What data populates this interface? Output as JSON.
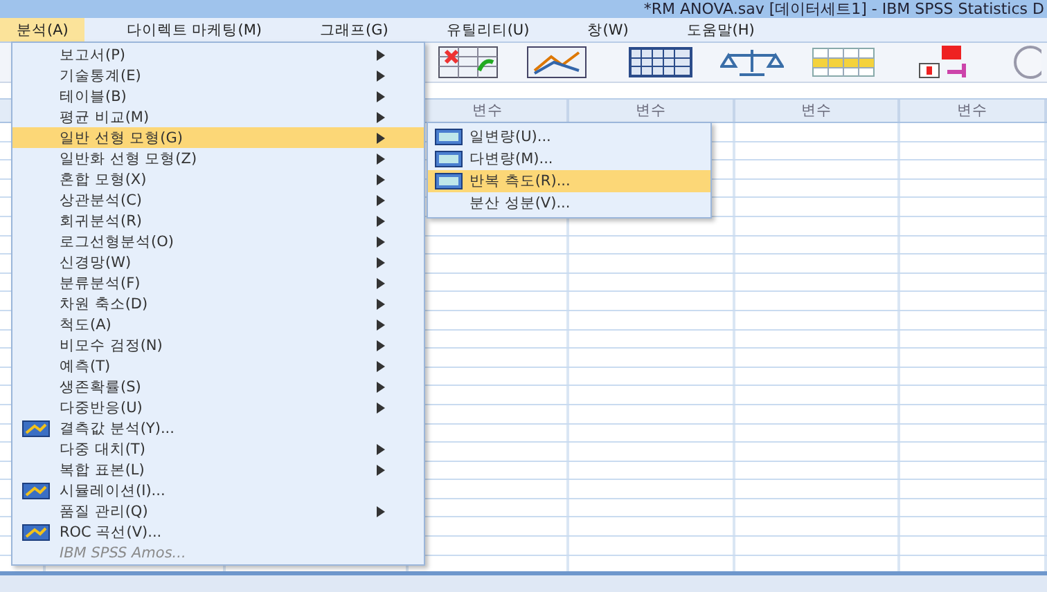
{
  "window": {
    "title": "*RM ANOVA.sav [데이터세트1] - IBM SPSS Statistics D"
  },
  "menubar": [
    {
      "label": "분석(A)",
      "selected": true
    },
    {
      "label": "다이렉트 마케팅(M)",
      "selected": false
    },
    {
      "label": "그래프(G)",
      "selected": false
    },
    {
      "label": "유틸리티(U)",
      "selected": false
    },
    {
      "label": "창(W)",
      "selected": false
    },
    {
      "label": "도움말(H)",
      "selected": false
    }
  ],
  "grid": {
    "columns": [
      "변수",
      "변수",
      "변수",
      "변수"
    ]
  },
  "menu": {
    "items": [
      {
        "label": "보고서(P)",
        "kind": "submenu",
        "selected": false,
        "disabled": false
      },
      {
        "label": "기술통계(E)",
        "kind": "submenu",
        "selected": false,
        "disabled": false
      },
      {
        "label": "테이블(B)",
        "kind": "submenu",
        "selected": false,
        "disabled": false
      },
      {
        "label": "평균 비교(M)",
        "kind": "submenu",
        "selected": false,
        "disabled": false
      },
      {
        "label": "일반 선형 모형(G)",
        "kind": "submenu",
        "selected": true,
        "disabled": false
      },
      {
        "label": "일반화 선형 모형(Z)",
        "kind": "submenu",
        "selected": false,
        "disabled": false
      },
      {
        "label": "혼합 모형(X)",
        "kind": "submenu",
        "selected": false,
        "disabled": false
      },
      {
        "label": "상관분석(C)",
        "kind": "submenu",
        "selected": false,
        "disabled": false
      },
      {
        "label": "회귀분석(R)",
        "kind": "submenu",
        "selected": false,
        "disabled": false
      },
      {
        "label": "로그선형분석(O)",
        "kind": "submenu",
        "selected": false,
        "disabled": false
      },
      {
        "label": "신경망(W)",
        "kind": "submenu",
        "selected": false,
        "disabled": false
      },
      {
        "label": "분류분석(F)",
        "kind": "submenu",
        "selected": false,
        "disabled": false
      },
      {
        "label": "차원 축소(D)",
        "kind": "submenu",
        "selected": false,
        "disabled": false
      },
      {
        "label": "척도(A)",
        "kind": "submenu",
        "selected": false,
        "disabled": false
      },
      {
        "label": "비모수 검정(N)",
        "kind": "submenu",
        "selected": false,
        "disabled": false
      },
      {
        "label": "예측(T)",
        "kind": "submenu",
        "selected": false,
        "disabled": false
      },
      {
        "label": "생존확률(S)",
        "kind": "submenu",
        "selected": false,
        "disabled": false
      },
      {
        "label": "다중반응(U)",
        "kind": "submenu",
        "selected": false,
        "disabled": false
      },
      {
        "label": "결측값 분석(Y)...",
        "kind": "command-icon",
        "selected": false,
        "disabled": false
      },
      {
        "label": "다중 대치(T)",
        "kind": "submenu",
        "selected": false,
        "disabled": false
      },
      {
        "label": "복합 표본(L)",
        "kind": "submenu",
        "selected": false,
        "disabled": false
      },
      {
        "label": "시뮬레이션(I)...",
        "kind": "command-icon",
        "selected": false,
        "disabled": false
      },
      {
        "label": "품질 관리(Q)",
        "kind": "submenu",
        "selected": false,
        "disabled": false
      },
      {
        "label": "ROC 곡선(V)...",
        "kind": "command-icon",
        "selected": false,
        "disabled": false
      },
      {
        "label": "IBM SPSS Amos...",
        "kind": "command",
        "selected": false,
        "disabled": true
      }
    ]
  },
  "submenu": {
    "items": [
      {
        "label": "일변량(U)...",
        "kind": "command-icon",
        "selected": false
      },
      {
        "label": "다변량(M)...",
        "kind": "command-icon",
        "selected": false
      },
      {
        "label": "반복 측도(R)...",
        "kind": "command-icon",
        "selected": true
      },
      {
        "label": "분산 성분(V)...",
        "kind": "command",
        "selected": false
      }
    ]
  }
}
